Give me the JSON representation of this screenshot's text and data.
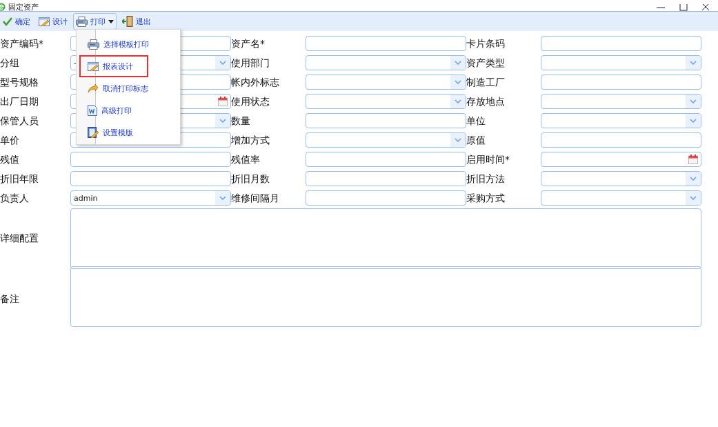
{
  "window": {
    "title": "固定资产"
  },
  "toolbar": [
    {
      "kind": "ok",
      "label": "确定",
      "expanded": false
    },
    {
      "kind": "design",
      "label": "设计",
      "expanded": false
    },
    {
      "kind": "print",
      "label": "打印",
      "expanded": true
    },
    {
      "kind": "exit",
      "label": "退出",
      "expanded": false
    }
  ],
  "print_menu": [
    {
      "kind": "printer",
      "label": "选择模板打印",
      "highlighted": false
    },
    {
      "kind": "design",
      "label": "报表设计",
      "highlighted": true
    },
    {
      "kind": "undo",
      "label": "取消打印标志",
      "highlighted": false
    },
    {
      "kind": "word",
      "label": "高级打印",
      "highlighted": false
    },
    {
      "kind": "template",
      "label": "设置模版",
      "highlighted": false
    }
  ],
  "form_rows": [
    [
      {
        "label": "资产编码*",
        "kind": "text"
      },
      {
        "label": "资产名*",
        "kind": "text"
      },
      {
        "label": "卡片条码",
        "kind": "text"
      }
    ],
    [
      {
        "label": "分组",
        "kind": "combo",
        "value": "-"
      },
      {
        "label": "使用部门",
        "kind": "combo"
      },
      {
        "label": "资产类型",
        "kind": "combo"
      }
    ],
    [
      {
        "label": "型号规格",
        "kind": "text"
      },
      {
        "label": "帐内外标志",
        "kind": "combo"
      },
      {
        "label": "制造工厂",
        "kind": "text"
      }
    ],
    [
      {
        "label": "出厂日期",
        "kind": "date"
      },
      {
        "label": "使用状态",
        "kind": "combo"
      },
      {
        "label": "存放地点",
        "kind": "combo"
      }
    ],
    [
      {
        "label": "保管人员",
        "kind": "combo"
      },
      {
        "label": "数量",
        "kind": "text"
      },
      {
        "label": "单位",
        "kind": "combo"
      }
    ],
    [
      {
        "label": "单价",
        "kind": "text"
      },
      {
        "label": "增加方式",
        "kind": "combo"
      },
      {
        "label": "原值",
        "kind": "text"
      }
    ],
    [
      {
        "label": "残值",
        "kind": "text"
      },
      {
        "label": "残值率",
        "kind": "text"
      },
      {
        "label": "启用时间*",
        "kind": "date"
      }
    ],
    [
      {
        "label": "折旧年限",
        "kind": "text"
      },
      {
        "label": "折旧月数",
        "kind": "text"
      },
      {
        "label": "折旧方法",
        "kind": "combo"
      }
    ],
    [
      {
        "label": "负责人",
        "kind": "combo",
        "value": "admin"
      },
      {
        "label": "维修间隔月",
        "kind": "text"
      },
      {
        "label": "采购方式",
        "kind": "combo"
      }
    ]
  ],
  "text_areas": [
    {
      "label": "详细配置"
    },
    {
      "label": "备注"
    }
  ]
}
